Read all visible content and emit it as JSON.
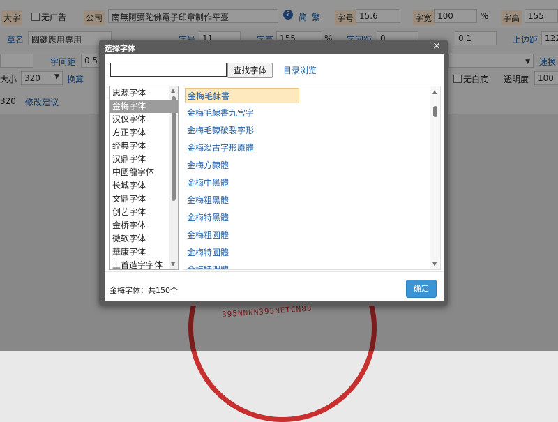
{
  "toolbar": {
    "big_char_label": "大字",
    "no_ads_label": "无广告",
    "company_label": "公司",
    "company_value": "南無阿彌陀佛電子印章制作平臺",
    "simp_label": "简",
    "trad_label": "繁",
    "font_size_label": "字号",
    "font_size_value": "15.6",
    "char_width_label": "字宽",
    "char_width_value": "100",
    "percent": "%",
    "char_height_label": "字高",
    "char_height_value": "155",
    "seal_name_label": "章名",
    "seal_name_value": "關鍵應用專用",
    "font_size2_label": "字号",
    "font_size2_value": "11",
    "char_height2_label": "字高",
    "char_height2_value": "155",
    "percent2": "%",
    "char_spacing_label": "字间距",
    "char_spacing_value": "0",
    "row_spacing_value": "0.1",
    "top_margin_label": "上边距",
    "top_margin_value": "122",
    "char_spacing2_label": "字间距",
    "char_spacing2_value": "0.5",
    "replace_label": "速换",
    "size_label": "大小",
    "size_value": "320",
    "convert_label": "换算",
    "no_white_bg_label": "无白底",
    "opacity_label": "透明度",
    "opacity_value": "100",
    "size_num": "320",
    "suggest_label": "修改建议"
  },
  "seal": {
    "text": "395NNNN395NETCN88",
    "color": "#c8302f"
  },
  "dialog": {
    "title": "选择字体",
    "close": "×",
    "search_button": "查找字体",
    "browse_link": "目录浏览",
    "categories": [
      "思源字体",
      "金梅字体",
      "汉仪字体",
      "方正字体",
      "经典字体",
      "汉鼎字体",
      "中國龍字体",
      "长城字体",
      "文鼎字体",
      "创艺字体",
      "金桥字体",
      "微软字体",
      "華康字体",
      "上首造字字体"
    ],
    "selected_category": 1,
    "fonts": [
      "金梅毛隸書",
      "金梅毛隸書九宮字",
      "金梅毛隸破裂字形",
      "金梅淡古字形原體",
      "金梅方隸體",
      "金梅中黑體",
      "金梅粗黑體",
      "金梅特黑體",
      "金梅粗圓體",
      "金梅特圓體",
      "金梅特明體"
    ],
    "selected_font": 0,
    "count_text": "金梅字体：共150个",
    "ok_button": "确定"
  },
  "colors": {
    "accent": "#3a95d6",
    "link": "#1f5fa8",
    "highlight": "#fde9bd"
  }
}
